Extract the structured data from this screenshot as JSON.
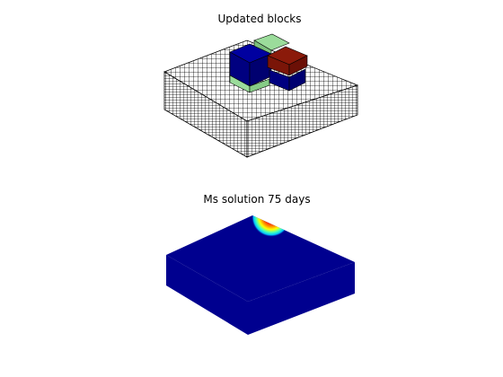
{
  "figure": {
    "panels": [
      {
        "title": "Updated blocks",
        "kind": "3d-grid-wireframe",
        "colors": {
          "mesh": "#000000",
          "cell_fill": "#ffffff",
          "block_blue": "#00008f",
          "block_green": "#9bdc9b",
          "block_red": "#8b1a0a"
        }
      },
      {
        "title": "Ms solution 75 days",
        "kind": "3d-surface-colormap",
        "colormap": "jet",
        "colors": {
          "base": "#00008f",
          "edge": "#00007a",
          "hot_1": "#ffff00",
          "hot_2": "#ff8000",
          "hot_3": "#ff0000",
          "hot_4": "#8b0000",
          "mid": "#00c0ff",
          "mid_2": "#40ffbf"
        }
      }
    ]
  }
}
